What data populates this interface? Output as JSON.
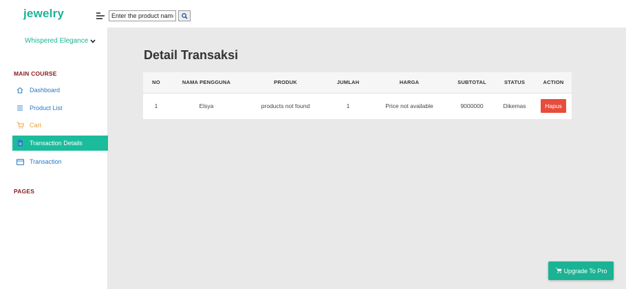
{
  "header": {
    "brand": "jewelry",
    "search_placeholder": "Enter the product name",
    "search_icon": "search-icon",
    "menu_icon": "menu-toggle-icon"
  },
  "sidebar": {
    "store_name": "Whispered Elegance",
    "section_main": "MAIN COURSE",
    "section_pages": "PAGES",
    "items": [
      {
        "label": "Dashboard",
        "icon": "home-icon"
      },
      {
        "label": "Product List",
        "icon": "list-icon"
      },
      {
        "label": "Cart",
        "icon": "cart-icon"
      },
      {
        "label": "Transaction Details",
        "icon": "document-icon",
        "active": true
      },
      {
        "label": "Transaction",
        "icon": "credit-card-icon"
      }
    ]
  },
  "main": {
    "title": "Detail Transaksi",
    "table": {
      "headers": [
        "NO",
        "NAMA PENGGUNA",
        "PRODUK",
        "JUMLAH",
        "HARGA",
        "SUBTOTAL",
        "STATUS",
        "ACTION"
      ],
      "rows": [
        {
          "no": "1",
          "user": "Elsya",
          "product": "products not found",
          "qty": "1",
          "price": "Price not available",
          "subtotal": "9000000",
          "status": "Dikemas",
          "action": "Hapus"
        }
      ]
    }
  },
  "upgrade_label": "Upgrade To Pro",
  "colors": {
    "brand": "#1ab394",
    "active_nav": "#1abc9c",
    "link": "#2a78c7",
    "cart": "#e8a33c",
    "section": "#8b1a1a",
    "danger": "#e74c3c",
    "content_bg": "#e9e9e9"
  }
}
